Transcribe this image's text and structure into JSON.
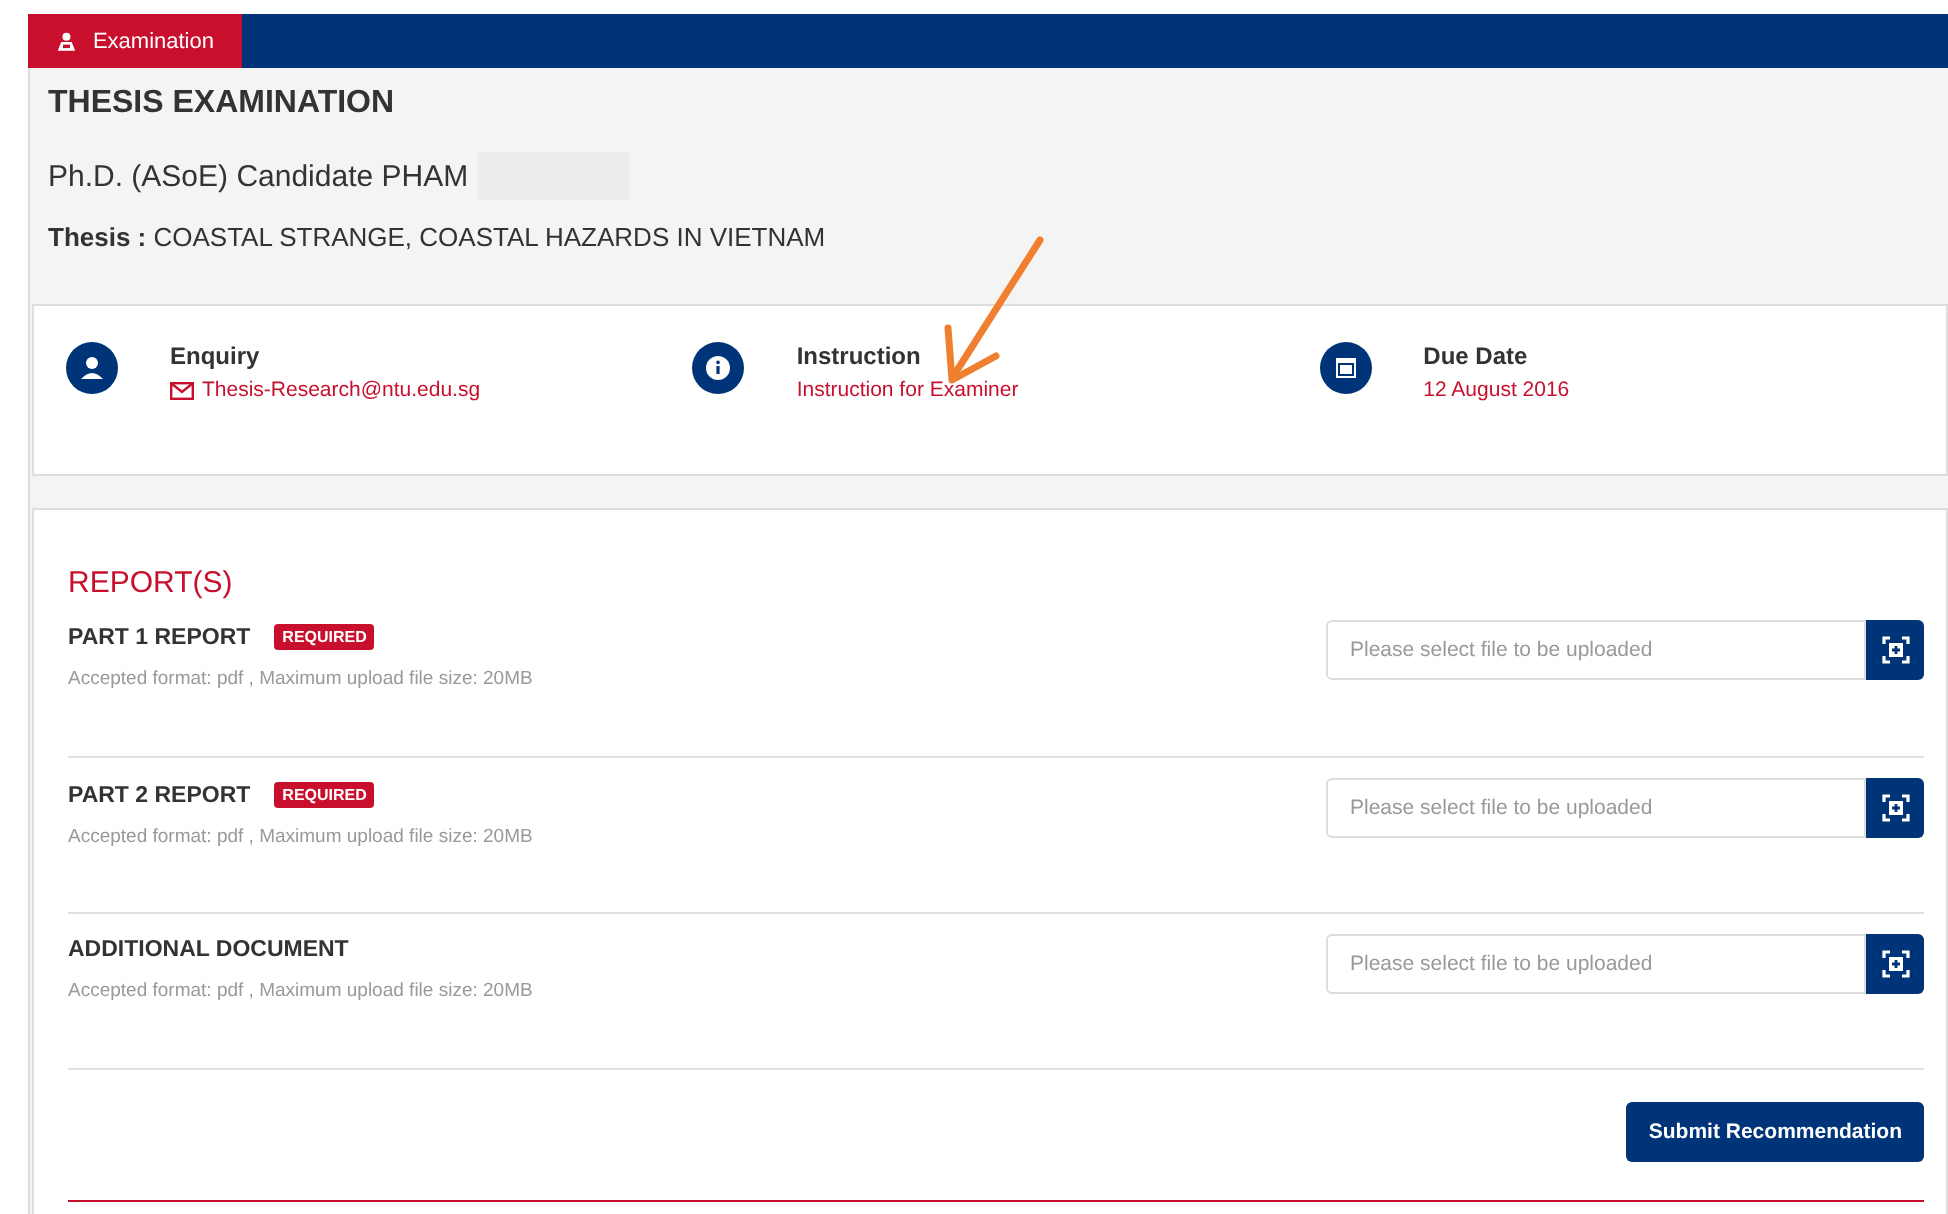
{
  "tab": {
    "label": "Examination",
    "selected": true
  },
  "title": "THESIS EXAMINATION",
  "candidate": "Ph.D. (ASoE) Candidate PHAM",
  "thesis": {
    "label": "Thesis :",
    "value": "COASTAL STRANGE, COASTAL HAZARDS IN VIETNAM"
  },
  "info": [
    {
      "kind": "enquiry",
      "label": "Enquiry",
      "value": "Thesis-Research@ntu.edu.sg"
    },
    {
      "kind": "instruction",
      "label": "Instruction",
      "value": "Instruction for Examiner"
    },
    {
      "kind": "due",
      "label": "Due Date",
      "value": "12 August 2016"
    }
  ],
  "reports_heading": "REPORT(S)",
  "reports": [
    {
      "title": "PART 1 REPORT",
      "badge": "REQUIRED",
      "note": "Accepted format: pdf , Maximum upload file size: 20MB",
      "placeholder": "Please select file to be uploaded"
    },
    {
      "title": "PART 2 REPORT",
      "badge": "REQUIRED",
      "note": "Accepted format: pdf , Maximum upload file size: 20MB",
      "placeholder": "Please select file to be uploaded"
    },
    {
      "title": "ADDITIONAL DOCUMENT",
      "note": "Accepted format: pdf , Maximum upload file size: 20MB",
      "placeholder": "Please select file to be uploaded"
    }
  ],
  "submit": "Submit Recommendation"
}
